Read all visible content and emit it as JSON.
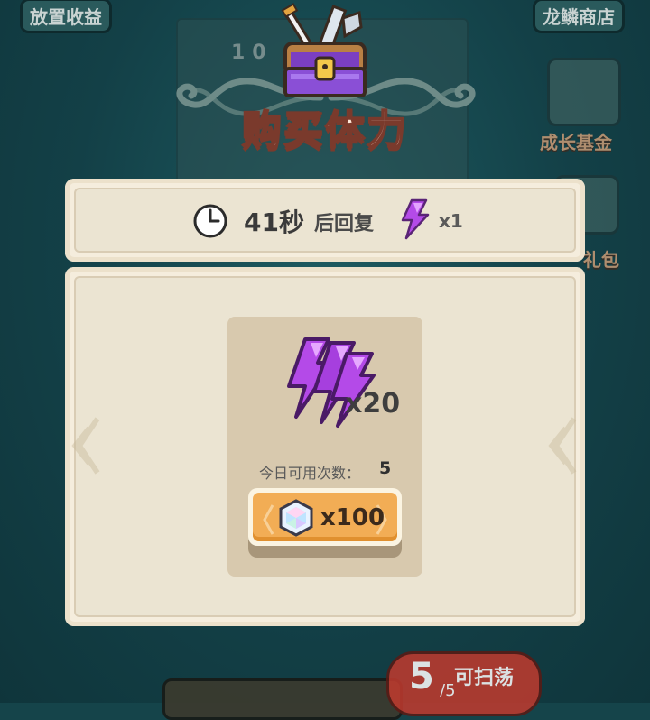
{
  "background": {
    "top_left_label": "放置收益",
    "top_right_label": "龙鳞商店",
    "side_label_1": "成长基金",
    "side_label_2": "礼包",
    "stage_title": "10 · 原",
    "sweep_count": "5",
    "sweep_total": "/5",
    "sweep_label": "可扫荡"
  },
  "dialog": {
    "title": "购买体力",
    "timer": {
      "value": "41秒",
      "suffix": "后回复",
      "energy_multiplier": "x1",
      "icon": "clock-icon"
    },
    "item": {
      "icon": "energy-bolts-icon",
      "quantity": "x20",
      "daily_label": "今日可用次数：",
      "daily_value": "5"
    },
    "buy_button": {
      "currency_icon": "diamond-gem-icon",
      "price": "x100"
    }
  },
  "colors": {
    "panel_bg": "#f5eddd",
    "card_bg": "#d8c9ae",
    "button_orange": "#f2ad55",
    "energy_purple": "#b44ae8",
    "title_text": "#ffe7d8",
    "title_outline": "#7a3a2c"
  }
}
